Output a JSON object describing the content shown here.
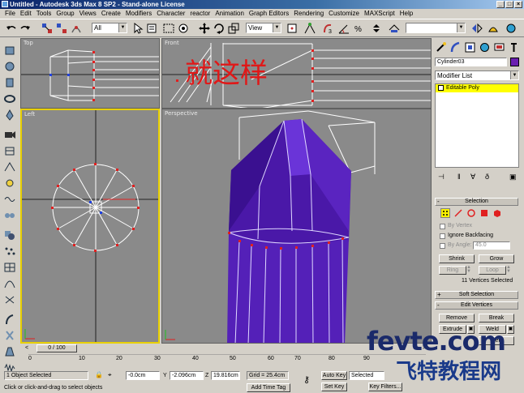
{
  "window": {
    "title": "Untitled - Autodesk 3ds Max 8 SP2 - Stand-alone License"
  },
  "menu": [
    "File",
    "Edit",
    "Tools",
    "Group",
    "Views",
    "Create",
    "Modifiers",
    "Character",
    "reactor",
    "Animation",
    "Graph Editors",
    "Rendering",
    "Customize",
    "MAXScript",
    "Help"
  ],
  "toolbar": {
    "selection_filter": "All",
    "reference_coord": "View"
  },
  "viewports": {
    "top": {
      "label": "Top"
    },
    "front": {
      "label": "Front",
      "overlay_text": "就这样"
    },
    "left": {
      "label": "Left"
    },
    "perspective": {
      "label": "Perspective"
    }
  },
  "command_panel": {
    "object_name": "Cylinder03",
    "object_color": "#6a1fb0",
    "modifier_list": "Modifier List",
    "stack_item": "Editable Poly",
    "selection": {
      "header": "Selection",
      "by_vertex": "By Vertex",
      "ignore_backfacing": "Ignore Backfacing",
      "by_angle": "By Angle:",
      "angle_value": "45.0",
      "shrink": "Shrink",
      "grow": "Grow",
      "ring": "Ring",
      "loop": "Loop",
      "status": "11 Vertices Selected"
    },
    "soft_selection": "Soft Selection",
    "edit_vertices": {
      "header": "Edit Vertices",
      "remove": "Remove",
      "break": "Break",
      "extrude": "Extrude",
      "weld": "Weld",
      "weld2": "Weld"
    }
  },
  "timeline": {
    "frame_display": "0 / 100",
    "ticks": [
      "0",
      "10",
      "20",
      "30",
      "40",
      "50",
      "60",
      "70",
      "80",
      "90"
    ]
  },
  "status": {
    "selection": "1 Object Selected",
    "prompt": "Click or click-and-drag to select objects",
    "x_value": "-0.0cm",
    "y_label": "Y",
    "y_value": "-2.096cm",
    "z_label": "Z",
    "z_value": "19.816cm",
    "grid": "Grid = 25.4cm",
    "add_time_tag": "Add Time Tag",
    "auto_key": "Auto Key",
    "set_key": "Set Key",
    "key_mode": "Selected",
    "key_filters": "Key Filters..."
  },
  "watermark": {
    "line1": "fevte.com",
    "line2": "飞特教程网"
  },
  "colors": {
    "accent": "#6a1fb0",
    "selected_viewport_border": "#e8d000",
    "stack_highlight": "#ffff00"
  }
}
